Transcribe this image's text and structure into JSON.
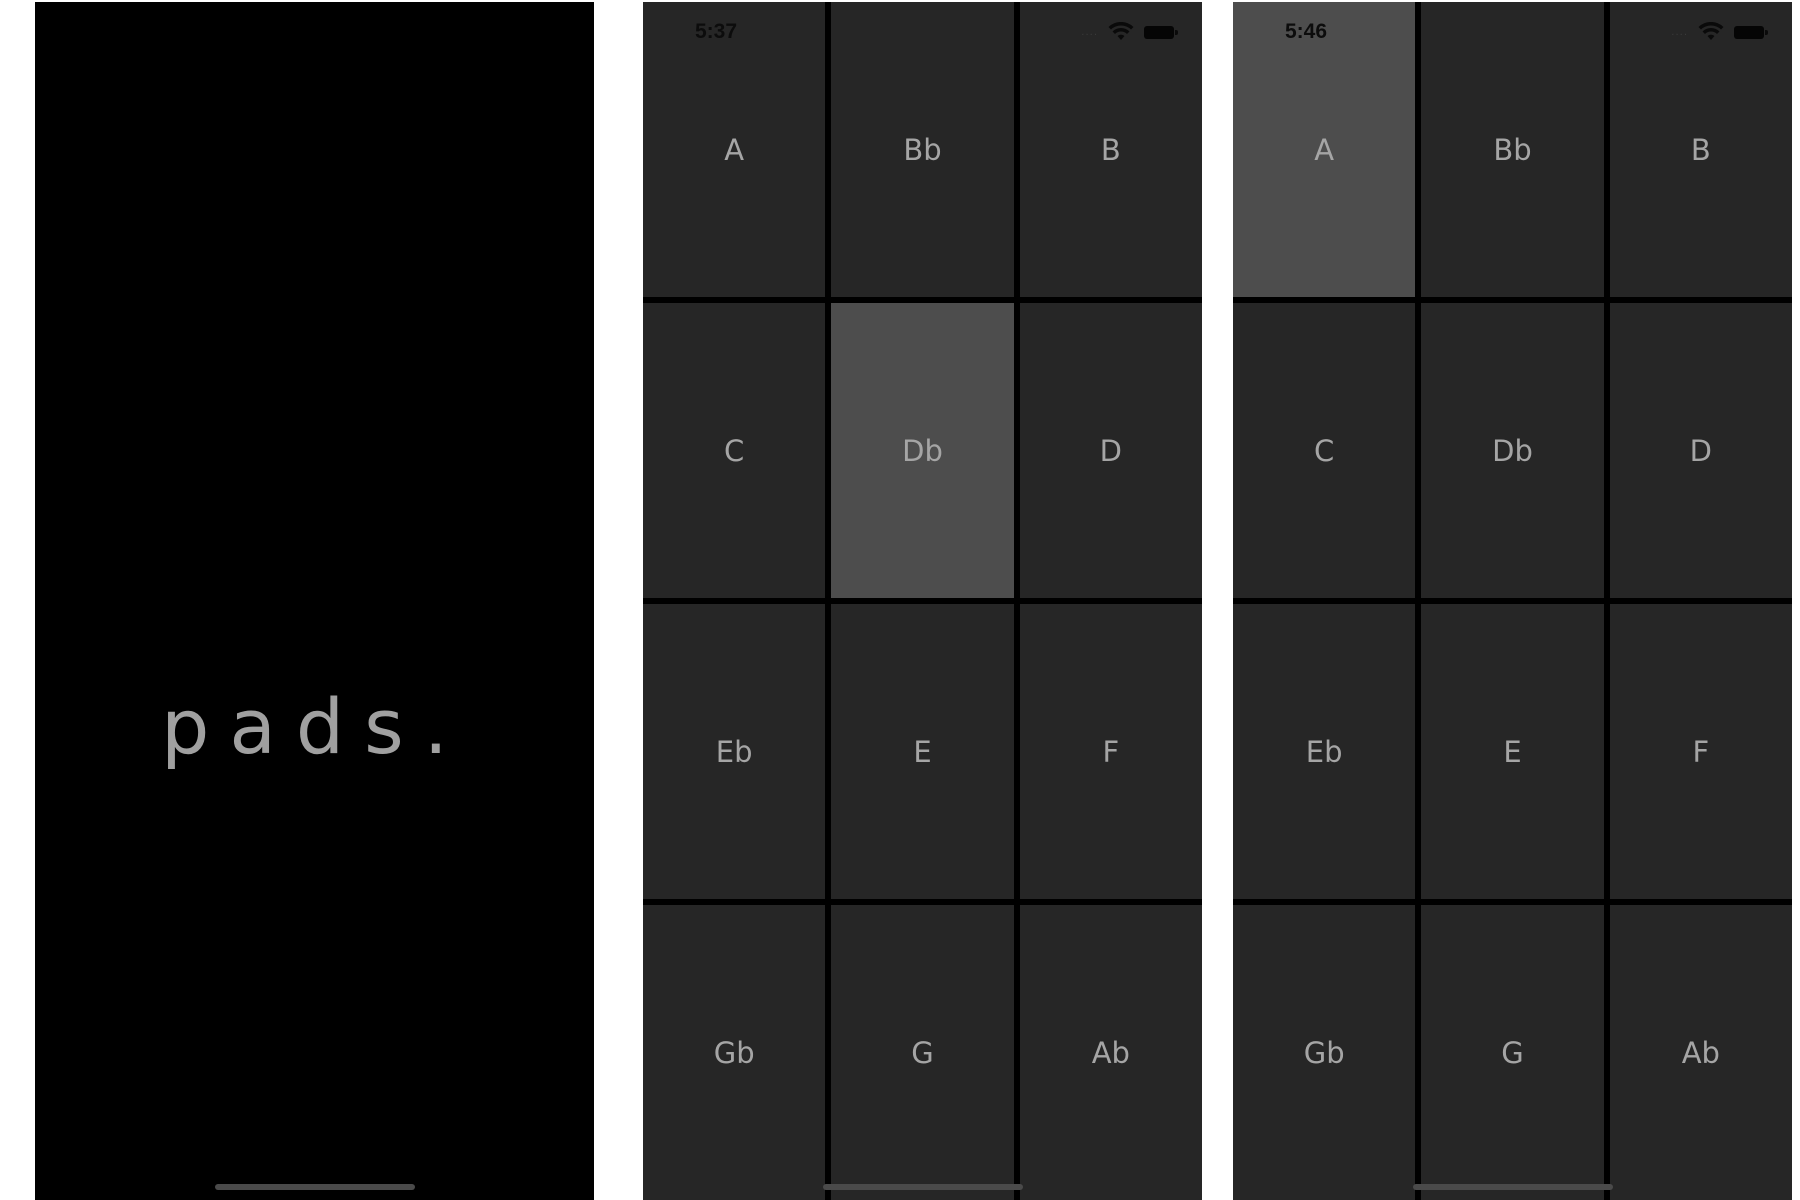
{
  "splash": {
    "title": "pads."
  },
  "screen_2": {
    "time": "5:37",
    "signal": "....",
    "active_pad": "Db",
    "pads": [
      "A",
      "Bb",
      "B",
      "C",
      "Db",
      "D",
      "Eb",
      "E",
      "F",
      "Gb",
      "G",
      "Ab"
    ]
  },
  "screen_3": {
    "time": "5:46",
    "signal": "....",
    "active_pad": "A",
    "pads": [
      "A",
      "Bb",
      "B",
      "C",
      "Db",
      "D",
      "Eb",
      "E",
      "F",
      "Gb",
      "G",
      "Ab"
    ]
  },
  "colors": {
    "pad": "#262626",
    "pad_active": "#4d4d4d",
    "grid_lines": "#000000",
    "label": "#a5a5a5"
  },
  "icons": [
    "wifi-icon",
    "battery-icon",
    "signal-dots"
  ]
}
